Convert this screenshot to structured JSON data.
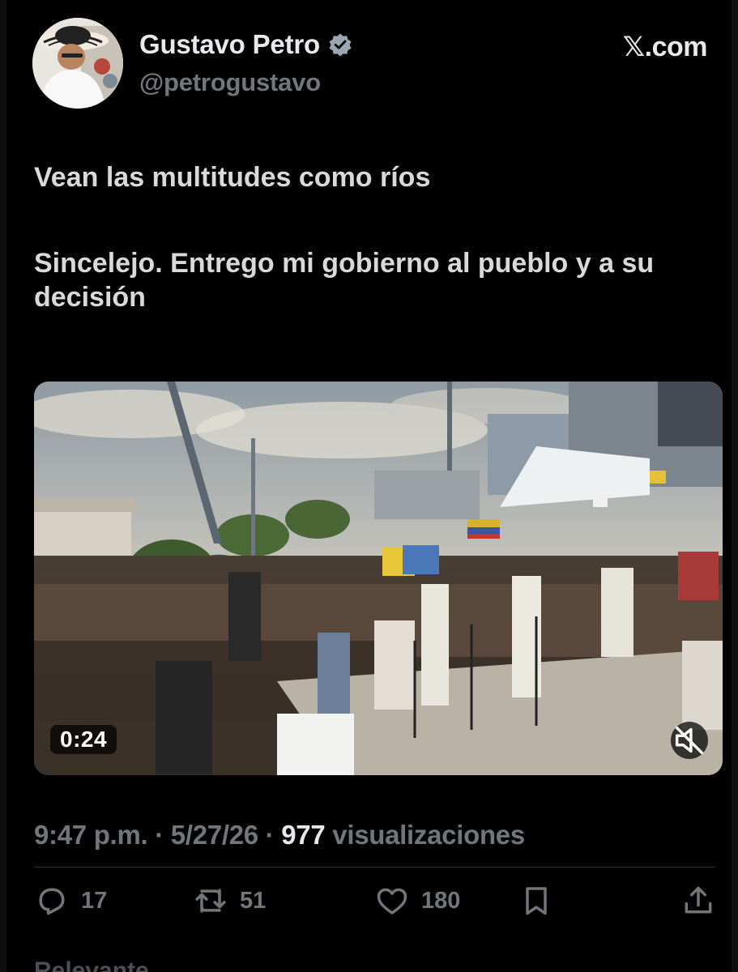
{
  "author": {
    "display_name": "Gustavo Petro",
    "handle": "@petrogustavo",
    "verified": true,
    "verified_color": "#9aa6b2"
  },
  "brand": {
    "mark": "𝕏",
    "label": ".com"
  },
  "tweet": {
    "paragraphs": [
      "Vean las multitudes como ríos",
      "Sincelejo. Entrego mi gobierno al pueblo y a su decisión"
    ]
  },
  "media": {
    "type": "video",
    "duration": "0:24",
    "muted": true
  },
  "meta": {
    "time": "9:47 p.m.",
    "separator": " · ",
    "date": "5/27/26",
    "views_count": "977",
    "views_label": "visualizaciones"
  },
  "actions": {
    "replies": "17",
    "reposts": "51",
    "likes": "180"
  },
  "footer": {
    "cutoff_text": "Relevante"
  },
  "icons": {
    "reply": "reply-icon",
    "repost": "repost-icon",
    "like": "heart-icon",
    "bookmark": "bookmark-icon",
    "share": "share-icon",
    "mute": "mute-icon",
    "verified": "verified-badge-icon"
  }
}
